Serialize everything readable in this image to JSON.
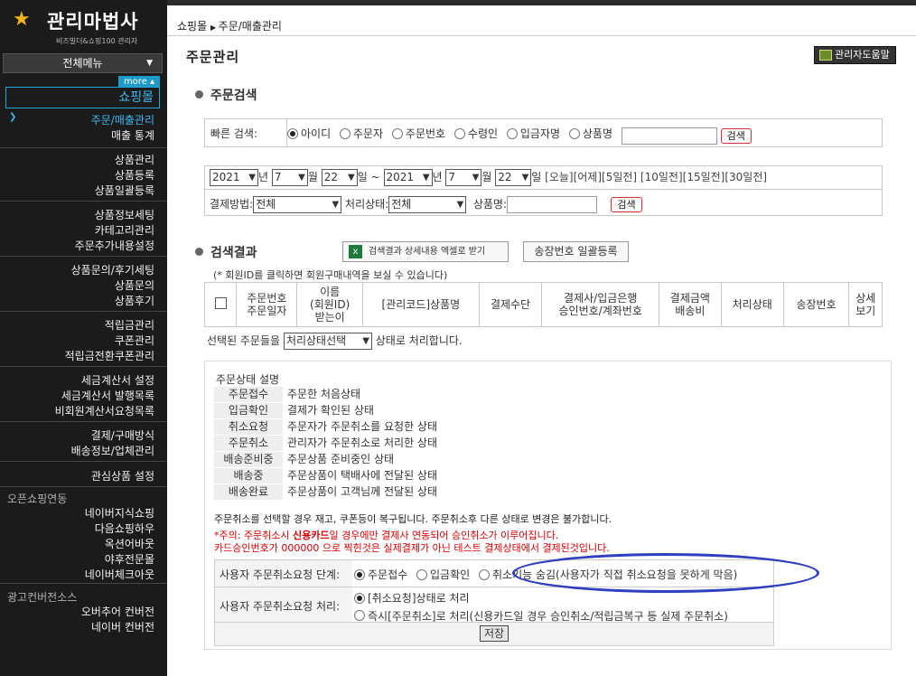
{
  "sidebar": {
    "logo_title": "관리마법사",
    "logo_sub": "비즈빌더&쇼핑100 관리자",
    "all_menu": "전체메뉴",
    "more": "more",
    "section": "쇼핑몰",
    "groups": [
      [
        "주문/매출관리",
        "매출 통계"
      ],
      [
        "상품관리",
        "상품등록",
        "상품일괄등록"
      ],
      [
        "상품정보세팅",
        "카테고리관리",
        "주문추가내용설정"
      ],
      [
        "상품문의/후기세팅",
        "상품문의",
        "상품후기"
      ],
      [
        "적립금관리",
        "쿠폰관리",
        "적립금전환쿠폰관리"
      ],
      [
        "세금계산서 설정",
        "세금계산서 발행목록",
        "비회원계산서요청목록"
      ],
      [
        "결제/구매방식",
        "배송정보/업체관리"
      ],
      [
        "관심상품 설정"
      ]
    ],
    "open_head": "오픈쇼핑연동",
    "open_items": [
      "네이버지식쇼핑",
      "다음쇼핑하우",
      "옥션어바웃",
      "야후전문몰",
      "네이버체크아웃"
    ],
    "ad_head": "광고컨버전소스",
    "ad_items": [
      "오버추어 컨버전",
      "네이버 컨버전"
    ]
  },
  "breadcrumb": {
    "a": "쇼핑몰",
    "b": "주문/매출관리"
  },
  "page_title": "주문관리",
  "help_button": "관리자도움말",
  "search": {
    "section_title": "주문검색",
    "quick_label": "빠른 검색:",
    "options": [
      "아이디",
      "주문자",
      "주문번호",
      "수령인",
      "입금자명",
      "상품명"
    ],
    "selected": "아이디",
    "search_btn": "검색",
    "date": {
      "from_year": "2021",
      "from_month": "7",
      "from_day": "22",
      "to_year": "2021",
      "to_month": "7",
      "to_day": "22",
      "year_unit": "년",
      "month_unit": "월",
      "day_unit": "일",
      "tilde": "~",
      "presets": "[오늘][어제][5일전] [10일전][15일전][30일전]"
    },
    "pay_label": "결제방법:",
    "pay_value": "전체",
    "state_label": "처리상태:",
    "state_value": "전체",
    "product_label": "상품명:",
    "search_btn2": "검색"
  },
  "results": {
    "section_title": "검색결과",
    "excel_btn": "검색결과 상세내용 엑셀로 받기",
    "tracking_btn": "송장번호 일괄등록",
    "note": "(* 회원ID를 클릭하면 회원구매내역을 보실 수 있습니다)",
    "headers": [
      "주문번호\n주문일자",
      "이름\n(회원ID)\n받는이",
      "[관리코드]상품명",
      "결제수단",
      "결제사/입금은행\n승인번호/계좌번호",
      "결제금액\n배송비",
      "처리상태",
      "송장번호",
      "상세\n보기"
    ],
    "bulk_prefix": "선택된 주문들을",
    "bulk_select": "처리상태선택",
    "bulk_suffix": "상태로 처리합니다."
  },
  "status": {
    "title": "주문상태 설명",
    "rows": [
      {
        "k": "주문접수",
        "v": "주문한 처음상태"
      },
      {
        "k": "입금확인",
        "v": "결제가 확인된 상태"
      },
      {
        "k": "취소요청",
        "v": "주문자가 주문취소를 요청한 상태"
      },
      {
        "k": "주문취소",
        "v": "관리자가 주문취소로 처리한 상태"
      },
      {
        "k": "배송준비중",
        "v": "주문상품 준비중인 상태"
      },
      {
        "k": "배송중",
        "v": "주문상품이 택배사에 전달된 상태"
      },
      {
        "k": "배송완료",
        "v": "주문상품이 고객님께 전달된 상태"
      }
    ],
    "notice": "주문취소를 선택할 경우 재고, 쿠폰등이 복구됩니다. 주문취소후 다른 상태로 변경은 불가합니다.",
    "warn1_a": "*주의: 주문취소시 ",
    "warn1_b": "신용카드",
    "warn1_c": "일 경우에만 결제사 연동되어 승인취소가 이루어집니다.",
    "warn2": "카드승인번호가 000000 으로 찍힌것은 실제결제가 아닌 테스트 결제상태에서 결제된것입니다.",
    "cancel_stage_label": "사용자 주문취소요청 단계:",
    "cancel_stage_opts": [
      "주문접수",
      "입금확인",
      "취소기능 숨김(사용자가 직접 취소요청을 못하게 막음)"
    ],
    "cancel_proc_label": "사용자 주문취소요청 처리:",
    "cancel_proc_opts": [
      "[취소요청]상태로 처리",
      "즉시[주문취소]로 처리(신용카드일 경우 승인취소/적립금복구 등 실제 주문취소)"
    ],
    "save_btn": "저장"
  }
}
